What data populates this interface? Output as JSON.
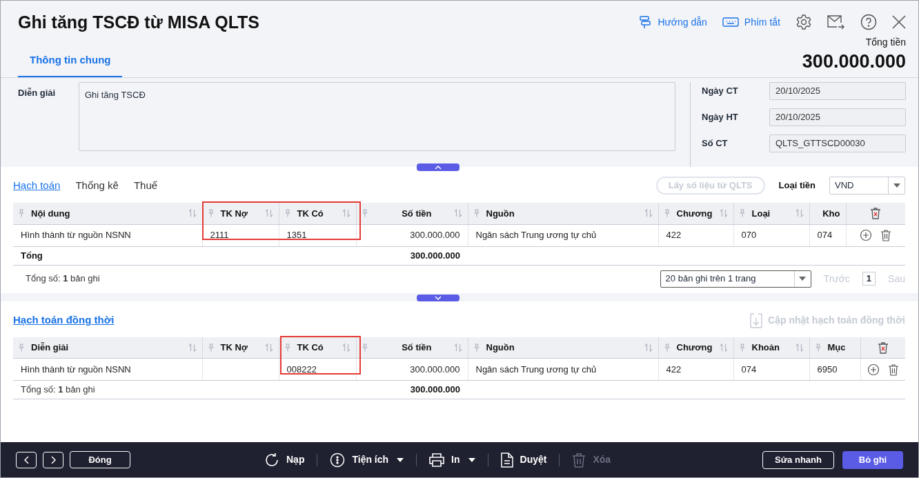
{
  "window": {
    "title": "Ghi tăng TSCĐ từ MISA QLTS"
  },
  "header_links": [
    {
      "kind": "guide",
      "label": "Hướng dẫn"
    },
    {
      "kind": "shortcuts",
      "label": "Phím tắt"
    }
  ],
  "total": {
    "label": "Tổng tiền",
    "value": "300.000.000"
  },
  "tabs": [
    {
      "label": "Thông tin chung",
      "selected": true
    }
  ],
  "form": {
    "description": {
      "label": "Diễn giải",
      "value": "Ghi tăng TSCĐ"
    },
    "fields": [
      {
        "label": "Ngày CT",
        "value": "20/10/2025"
      },
      {
        "label": "Ngày HT",
        "value": "20/10/2025"
      },
      {
        "label": "Số CT",
        "value": "QLTS_GTTSCD00030"
      }
    ]
  },
  "posting": {
    "tabs": [
      {
        "label": "Hạch toán",
        "selected": true
      },
      {
        "label": "Thống kê",
        "selected": false
      },
      {
        "label": "Thuế",
        "selected": false
      }
    ],
    "fetch_button": {
      "label": "Lấy số liệu từ QLTS",
      "disabled": true
    },
    "currency": {
      "label": "Loại tiền",
      "value": "VND"
    },
    "table": {
      "columns": [
        {
          "label": "Nội dung",
          "kind": "text",
          "highlighted": false
        },
        {
          "label": "TK Nợ",
          "kind": "text",
          "highlighted": true
        },
        {
          "label": "TK Có",
          "kind": "text",
          "highlighted": true
        },
        {
          "label": "Số tiền",
          "kind": "amount",
          "highlighted": false
        },
        {
          "label": "Nguồn",
          "kind": "text",
          "highlighted": false
        },
        {
          "label": "Chương",
          "kind": "text",
          "highlighted": false
        },
        {
          "label": "Loại",
          "kind": "text",
          "highlighted": false
        },
        {
          "label": "Kho",
          "kind": "text",
          "highlighted": false
        }
      ],
      "rows": [
        {
          "cells": [
            "Hình thành từ nguồn NSNN",
            "2111",
            "1351",
            "300.000.000",
            "Ngân sách Trung ương tự chủ",
            "422",
            "070",
            "074"
          ]
        }
      ],
      "total_row": {
        "label": "Tổng",
        "amount": "300.000.000"
      }
    },
    "summary": "Tổng số: **1** bản ghi",
    "pager": {
      "page_size": "20 bản ghi trên 1 trang",
      "prev": "Trước",
      "page": "1",
      "next": "Sau"
    }
  },
  "concurrent": {
    "title": "Hạch toán đồng thời",
    "update_button": {
      "label": "Cập nhật hạch toán đồng thời",
      "disabled": true
    },
    "table": {
      "columns": [
        {
          "label": "Diễn giải",
          "kind": "text",
          "highlighted": false
        },
        {
          "label": "TK Nợ",
          "kind": "text",
          "highlighted": false
        },
        {
          "label": "TK Có",
          "kind": "text",
          "highlighted": true
        },
        {
          "label": "Số tiền",
          "kind": "amount",
          "highlighted": false
        },
        {
          "label": "Nguồn",
          "kind": "text",
          "highlighted": false
        },
        {
          "label": "Chương",
          "kind": "text",
          "highlighted": false
        },
        {
          "label": "Khoản",
          "kind": "text",
          "highlighted": false
        },
        {
          "label": "Mục",
          "kind": "text",
          "highlighted": false
        }
      ],
      "rows": [
        {
          "cells": [
            "Hình thành từ nguồn NSNN",
            "",
            "008222",
            "300.000.000",
            "Ngân sách Trung ương tự chủ",
            "422",
            "074",
            "6950"
          ]
        }
      ]
    },
    "summary": "Tổng số: **1** bản ghi",
    "total_amount": "300.000.000"
  },
  "bottom_bar": {
    "left": [
      {
        "kind": "prev"
      },
      {
        "kind": "next"
      },
      {
        "kind": "text",
        "label": "Đóng"
      }
    ],
    "center": [
      {
        "kind": "reload",
        "label": "Nạp",
        "menu": false,
        "disabled": false
      },
      {
        "kind": "utilities",
        "label": "Tiện ích",
        "menu": true,
        "disabled": false
      },
      {
        "kind": "print",
        "label": "In",
        "menu": true,
        "disabled": false
      },
      {
        "kind": "approve",
        "label": "Duyệt",
        "menu": false,
        "disabled": false
      },
      {
        "kind": "delete",
        "label": "Xóa",
        "menu": false,
        "disabled": true
      }
    ],
    "right": [
      {
        "kind": "outline",
        "label": "Sửa nhanh"
      },
      {
        "kind": "primary",
        "label": "Bỏ ghi"
      }
    ]
  }
}
